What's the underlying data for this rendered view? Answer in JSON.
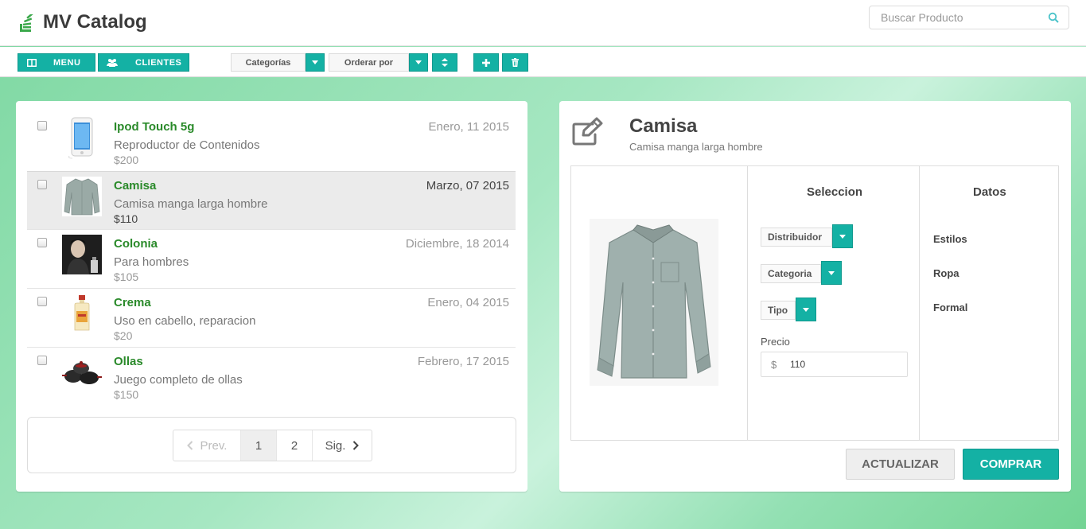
{
  "app": {
    "title": "MV Catalog",
    "logo_icon": "stack-icon"
  },
  "search": {
    "placeholder": "Buscar Producto",
    "value": "",
    "icon": "search-icon"
  },
  "toolbar": {
    "menu_label": "MENU",
    "menu_icon": "columns-icon",
    "clientes_label": "CLIENTES",
    "clientes_icon": "users-icon",
    "categorias_label": "Categorías",
    "ordenar_label": "Orderar por",
    "sort_icon": "sort-icon",
    "add_icon": "plus-icon",
    "delete_icon": "trash-icon",
    "accent_color": "#14b1a4"
  },
  "products": [
    {
      "name": "Ipod Touch 5g",
      "desc": "Reproductor de Contenidos",
      "price": "$200",
      "date": "Enero, 11 2015",
      "selected": false
    },
    {
      "name": "Camisa",
      "desc": "Camisa manga larga hombre",
      "price": "$110",
      "date": "Marzo, 07 2015",
      "selected": true
    },
    {
      "name": "Colonia",
      "desc": "Para hombres",
      "price": "$105",
      "date": "Diciembre, 18 2014",
      "selected": false
    },
    {
      "name": "Crema",
      "desc": "Uso en cabello, reparacion",
      "price": "$20",
      "date": "Enero, 04 2015",
      "selected": false
    },
    {
      "name": "Ollas",
      "desc": "Juego completo de ollas",
      "price": "$150",
      "date": "Febrero, 17 2015",
      "selected": false
    }
  ],
  "pagination": {
    "prev": "Prev.",
    "pages": [
      "1",
      "2"
    ],
    "current": "1",
    "next": "Sig."
  },
  "detail": {
    "title": "Camisa",
    "subtitle": "Camisa manga larga hombre",
    "edit_icon": "edit-icon",
    "seleccion_header": "Seleccion",
    "datos_header": "Datos",
    "selects": {
      "distribuidor": "Distribuidor",
      "categoria": "Categoria",
      "tipo": "Tipo"
    },
    "price_label": "Precio",
    "currency": "$",
    "price_value": "110",
    "datos": [
      "Estilos",
      "Ropa",
      "Formal"
    ],
    "update_label": "ACTUALIZAR",
    "buy_label": "COMPRAR"
  }
}
